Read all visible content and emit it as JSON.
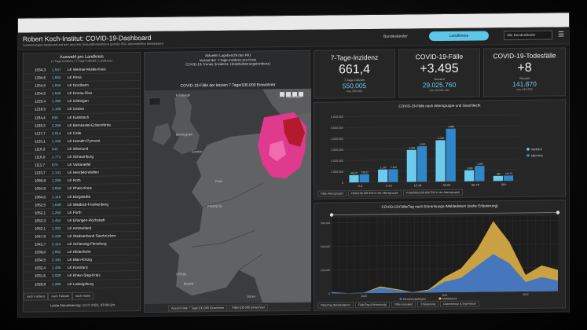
{
  "app": {
    "title": "Robert Koch-Institut: COVID-19-Dashboard",
    "subtitle": "Auswertungen basierend auf den aus den Gesundheitsämtern gemäß IfSG übermittelten Meldedaten",
    "tab_bundeslaender": "Bundesländer",
    "tab_landkreise": "Landkreise",
    "select_value": "Alle Bundesländer",
    "menu_icon": "hamburger-menu-icon"
  },
  "list": {
    "title": "Auswahl pro Landkreis",
    "subtitle": "(7-Tage-Inzidenz | 7-Tage-Fallzahl | Landkreis)",
    "rows": [
      [
        "1534,3",
        "1.557",
        "LK Weimar-Mulde-Kreis"
      ],
      [
        "1294,6",
        "1.664",
        "LK Pirna"
      ],
      [
        "1254,5",
        "1.655",
        "LK Nordheim"
      ],
      [
        "1254,0",
        "1.646",
        "LK Donau-Ries"
      ],
      [
        "1225,4",
        "1.390",
        "LK Göttingen"
      ],
      [
        "1218,5",
        "1.106",
        "LK Uelzen"
      ],
      [
        "1184,4",
        "846",
        "LK Kulmbach"
      ],
      [
        "1168,3",
        "2.256",
        "LK Bernkastel-Eckernförde"
      ],
      [
        "1127,7",
        "2.014",
        "LK Celle"
      ],
      [
        "1125,1",
        "1.446",
        "LK Hameln-Pyrmont"
      ],
      [
        "1118,3",
        "642",
        "LK Wittmund"
      ],
      [
        "1116,0",
        "1.771",
        "LK Schaumburg"
      ],
      [
        "1111,7",
        "675",
        "LK Vulkaneifel"
      ],
      [
        "1103,7",
        "1.141",
        "LK Hersfeld-Wolfen"
      ],
      [
        "1066,9",
        "1.289",
        "LK Roth"
      ],
      [
        "1064,9",
        "2.859",
        "LK Rhein-Kreis"
      ],
      [
        "1064,0",
        "1.116",
        "LK Borgstedte"
      ],
      [
        "1052,5",
        "1.649",
        "LK Waldeck-Frankenberg"
      ],
      [
        "1052,1",
        "1.250",
        "LK Fürth"
      ],
      [
        "1053,3",
        "1.454",
        "LK Erlangen-Höchstadt"
      ],
      [
        "1052,1",
        "1.332",
        "LK Ammerland"
      ],
      [
        "1047,9",
        "3.428",
        "LK Stadtverband Saarbrücken"
      ],
      [
        "1042,7",
        "2.113",
        "LK Schleswig-Flensburg"
      ],
      [
        "1039,0",
        "2.862",
        "LK Hildesheim"
      ],
      [
        "1034,5",
        "2.191",
        "LK Main-Kinzig"
      ],
      [
        "1032,4",
        "1.405",
        "LK Konstanz"
      ],
      [
        "1031,6",
        "2.028",
        "LK Rhein-Sieg-Kreis"
      ],
      [
        "1028,8",
        "1.286",
        "LK Ludwigsburg"
      ]
    ],
    "tab1": "nach Inzidenz",
    "tab2": "nach Fallzahl",
    "tab3": "nach Name",
    "footer": "Letzte Aktualisierung: 11.07.2022, 03:04 Uhr"
  },
  "map": {
    "line1": "Aktueller Lagebericht des RKI",
    "line2": "Verlauf der 7-Tage-Inzidenz pro Kreis",
    "line3": "COVID-19-Trends (Inzidenz, Hospitalisierungsinzidenz)",
    "title": "COVID-19-Fälle der letzten 7 Tage/100.000 Einwohner",
    "label_edinburgh": "Edinburgh",
    "label_birmingham": "Birmingham",
    "label_london": "London",
    "label_paris": "Paris",
    "label_france": "FRANCE",
    "label_spain": "SPAIN",
    "label_madrid": "Madrid",
    "label_sweden": "SWEDEN",
    "tab1": "Anzahl Fälle 7 Tage/100.000 Einwohner",
    "tab2": "Fälle/100.000 Einwohner",
    "scale": "300 km"
  },
  "kpis": [
    {
      "title": "7-Tage-Inzidenz",
      "value": "661,4",
      "label": "7-Tage-Fallzahl",
      "sub": "550.005",
      "note": "neu 550.005"
    },
    {
      "title": "COVID-19-Fälle",
      "value": "+3.495",
      "label": "Gesamt",
      "sub": "29.025.760",
      "note": "neu 29.025.760"
    },
    {
      "title": "COVID-19-Todesfälle",
      "value": "+8",
      "label": "Gesamt",
      "sub": "141.870",
      "note": "neu 141.870"
    }
  ],
  "bar_panel": {
    "title": "COVID-19-Fälle nach Altersgruppe und Geschlecht",
    "tab1": "Fälle Altersgruppe",
    "tab2": "Fälle/100.000 EW in der Altersgruppe",
    "tab3": "Todesfälle/100.000 EW in der Altersgruppe"
  },
  "line_panel": {
    "title": "COVID-19-Fälle/Tag nach Erkrankungs-/Meldedatum (siehe Erläuterung)",
    "tab1": "Fälle/Tag (Meldedatum)",
    "tab2": "Fälle/Tag (Erkrankung)",
    "tab3": "Fälle kumuliert",
    "tab4": "Erläuterung",
    "tab5": "Datenschutz & Impressum"
  },
  "colors": {
    "accent": "#5ec6e8",
    "female": "#6ccbec",
    "male": "#2f86c9",
    "series_a": "#2f6fd1",
    "series_b": "#e8b84a",
    "map_high": "#e03a8e",
    "map_very_high": "#b31b2c"
  },
  "chart_data": [
    {
      "type": "bar",
      "title": "COVID-19-Fälle nach Altersgruppe und Geschlecht",
      "categories": [
        "A00-A04",
        "A05-A14",
        "A15-A34",
        "A35-A59",
        "A60-A79",
        "A80+"
      ],
      "series": [
        {
          "name": "Weiblich",
          "values": [
            662000,
            1150000,
            2900000,
            3760000,
            1000000,
            460000
          ]
        },
        {
          "name": "Männlich",
          "values": [
            735000,
            1160000,
            3220000,
            4800000,
            1380000,
            480000
          ]
        }
      ],
      "labels_f": [
        "662,27",
        "1,145",
        "2,903",
        "3,760",
        "1,000",
        "460"
      ],
      "labels_m": [
        "735,27",
        "1,159",
        "3,220",
        "4,800",
        "1,380",
        "475,75"
      ],
      "xticks": [
        "0-4",
        "5-14",
        "15-34",
        "35-59",
        "60-79",
        "80+"
      ],
      "yticks": [
        "0",
        "1.000.000",
        "2.000.000",
        "3.000.000",
        "4.000.000",
        "5.000.000",
        "6.000.000"
      ],
      "ylim": [
        0,
        6000000
      ],
      "legend": [
        "Weiblich",
        "Männlich"
      ],
      "legend_position": "right"
    },
    {
      "type": "area",
      "title": "COVID-19-Fälle/Tag nach Erkrankungs-/Meldedatum",
      "x": [
        "2020-03",
        "2020-06",
        "2020-09",
        "2020-12",
        "2021-03",
        "2021-06",
        "2021-09",
        "2021-12",
        "2022-01",
        "2022-02",
        "2022-03",
        "2022-04",
        "2022-05",
        "2022-06",
        "2022-07"
      ],
      "series": [
        {
          "name": "Erkrankungsbeginn",
          "values": [
            5000,
            400,
            1500,
            22000,
            12000,
            2000,
            8000,
            45000,
            60000,
            110000,
            160000,
            120000,
            40000,
            60000,
            45000
          ]
        },
        {
          "name": "Meldedatum",
          "values": [
            6000,
            500,
            2000,
            28000,
            16000,
            2500,
            12000,
            65000,
            100000,
            180000,
            300000,
            210000,
            70000,
            110000,
            90000
          ]
        }
      ],
      "xticks": [
        "2020",
        "2021",
        "2022"
      ],
      "yticks": [
        "0",
        "100.000",
        "200.000",
        "300.000"
      ],
      "ylim": [
        0,
        320000
      ],
      "legend": [
        "Erkrankungsbeginn",
        "Meldedatum"
      ],
      "legend_position": "bottom"
    }
  ]
}
